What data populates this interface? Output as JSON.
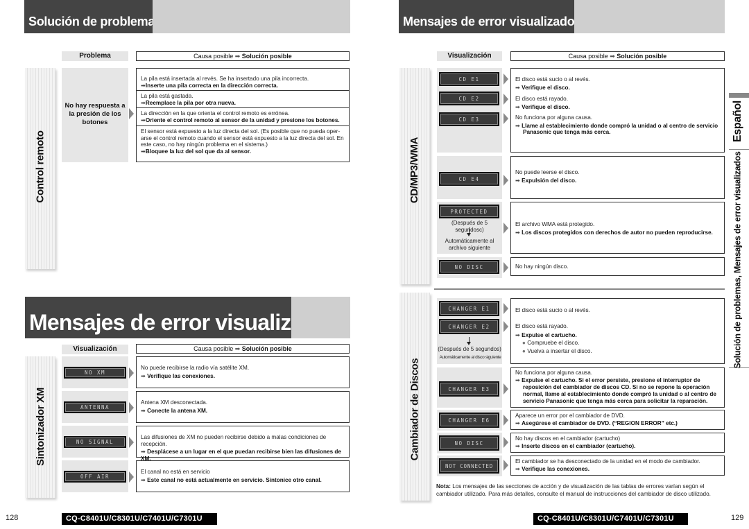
{
  "left_page": {
    "title": "Solución de problemas",
    "table_header": {
      "problem": "Problema",
      "cause": "Causa posible",
      "arrow": "➡",
      "solution": "Solución posible"
    },
    "section_remote": {
      "side_label": "Control remoto",
      "problem": "No hay respuesta a la presión de los botones",
      "rows": [
        {
          "cause": "La pila está insertada al revés. Se ha insertado una pila incorrecta.",
          "solution": "Inserte una pila correcta en la dirección correcta."
        },
        {
          "cause": "La pila está gastada.",
          "solution": "Reemplace la pila por otra nueva."
        },
        {
          "cause": "La dirección en la que orienta el control remoto es errónea.",
          "solution": "Oriente el control remoto al sensor de la unidad y presione los botones."
        },
        {
          "cause": "El sensor está expuesto a la luz directa del sol. (Es posible que no pueda oper-arse el control remoto cuando el sensor está expuesto a la luz directa del sol. En este caso, no hay ningún problema en el sistema.)",
          "solution": "Bloquee la luz del sol que da al sensor."
        }
      ]
    },
    "error_title": "Mensajes de error visualizados",
    "error_header": {
      "display": "Visualización",
      "cause": "Causa posible",
      "arrow": "➡",
      "solution": "Solución posible"
    },
    "section_xm": {
      "side_label": "Sintonizador XM",
      "rows": [
        {
          "display": "NO  XM",
          "cause": "No puede recibirse la radio vía satélite XM.",
          "solution": "Verifique las conexiones."
        },
        {
          "display": "ANTENNA",
          "cause": "Antena XM desconectada.",
          "solution": "Conecte la antena XM."
        },
        {
          "display": "NO SIGNAL",
          "cause": "Las difusiones de XM no pueden recibirse debido a malas condiciones de recepción.",
          "solution": "Desplácese a un lugar en el que puedan recibirse bien las difusiones de XM."
        },
        {
          "display": "OFF AIR",
          "cause": "El canal no está en servicio",
          "solution": "Este canal no está actualmente en servicio. Sintonice otro canal."
        }
      ]
    },
    "page_number": "128",
    "model": "CQ-C8401U/C8301U/C7401U/C7301U"
  },
  "right_page": {
    "title": "Mensajes de error visualizados",
    "table_header": {
      "display": "Visualización",
      "cause": "Causa posible",
      "arrow": "➡",
      "solution": "Solución posible"
    },
    "section_cd": {
      "side_label": "CD/MP3/WMA",
      "rows": [
        {
          "display": "CD  E1",
          "cause": "El disco está sucio o al revés.",
          "solution": "Verifique el disco."
        },
        {
          "display": "CD  E2",
          "cause": "El disco está rayado.",
          "solution": "Verifique el disco."
        },
        {
          "display": "CD  E3",
          "cause": "No funciona por alguna causa.",
          "solution": "Llame al establecimiento donde compró la unidad o al centro de servicio Panasonic que tenga más cerca."
        },
        {
          "display": "CD  E4",
          "cause": "No puede leerse el disco.",
          "solution": "Expulsión del disco."
        },
        {
          "display": "PROTECTED",
          "note_after": "(Después de 5 segundosc)",
          "note_auto": "Automáticamente al archivo siguiente",
          "cause": "El archivo WMA está protegido.",
          "solution": "Los discos protegidos con derechos de autor no pueden reproducirse."
        },
        {
          "display": "NO DISC",
          "cause": "No hay ningún disco."
        }
      ]
    },
    "section_changer": {
      "side_label": "Cambiador de Discos",
      "rows": [
        {
          "display": "CHANGER  E1",
          "cause": "El disco está sucio o al revés."
        },
        {
          "display": "CHANGER  E2",
          "note_after": "(Después de 5 segundos)",
          "note_auto": "Automáticamente al disco siguiente",
          "cause": "El disco está rayado.",
          "solution": "Expulse el cartucho.",
          "bullets": [
            "Compruebe el disco.",
            "Vuelva a insertar el disco."
          ]
        },
        {
          "display": "CHANGER  E3",
          "cause": "No funciona por alguna causa.",
          "solution": "Expulse el cartucho. Si el error persiste, presione el interruptor de reposición del cambiador de discos CD. Si no se repone la operación normal, llame al establecimiento donde compró la unidad o al centro de servicio Panasonic que tenga más cerca para solicitar la reparación."
        },
        {
          "display": "CHANGER  E6",
          "cause": "Aparece un error por el cambiador de DVD.",
          "solution": "Asegúrese el cambiador de DVD. (“REGION ERROR” etc.)"
        },
        {
          "display": "NO DISC",
          "cause": "No hay discos en el cambiador (cartucho)",
          "solution": "Inserte discos en el cambiador (cartucho)."
        },
        {
          "display": "NOT CONNECTED",
          "cause": "El cambiador se ha desconectado de la unidad en el modo de cambiador.",
          "solution": "Verifique las conexiones."
        }
      ]
    },
    "note_label": "Nota:",
    "note_text": "Los mensajes de las secciones de acción y de visualización de las tablas de errores varían según el cambiador utilizado. Para más detalles, consulte el manual de instrucciones del cambiador de disco utilizado.",
    "language_tab": "Español",
    "running_head": "Solución de problemas, Mensajes de error visualizados",
    "page_number": "129",
    "model": "CQ-C8401U/C8301U/C7401U/C7301U"
  }
}
